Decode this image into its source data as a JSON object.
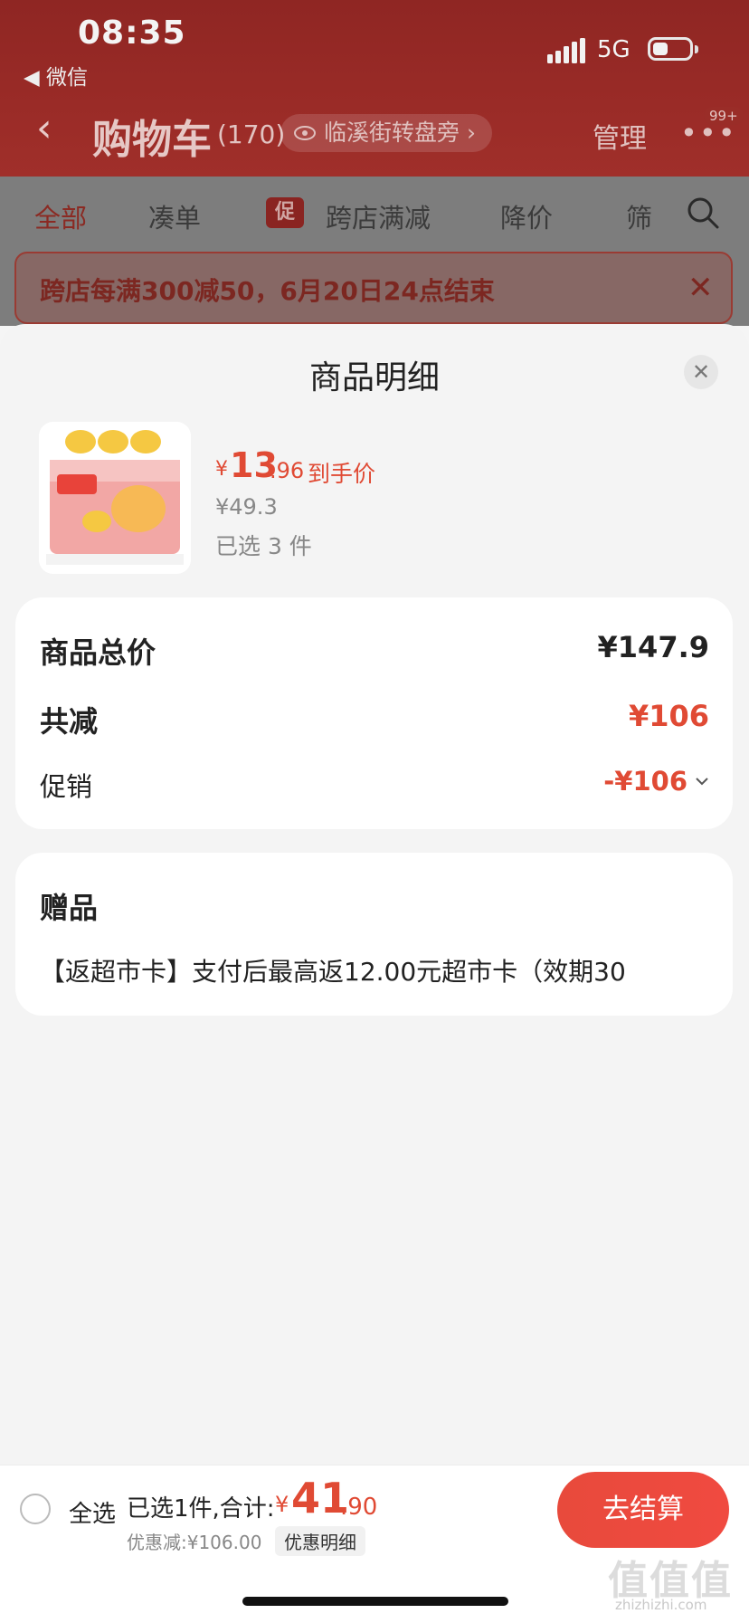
{
  "status_bar": {
    "time": "08:35",
    "back_app": "◀ 微信",
    "network": "5G"
  },
  "header": {
    "back_icon": "chevron-left-icon",
    "title": "购物车",
    "count": "(170)",
    "location": "临溪街转盘旁",
    "manage": "管理",
    "more": "•••",
    "badge": "99+"
  },
  "tabs": {
    "items": [
      "全部",
      "凑单",
      "跨店满减",
      "降价",
      "筛"
    ],
    "promo_tag": "促"
  },
  "banner": {
    "text": "跨店每满300减50，6月20日24点结束",
    "close": "✕"
  },
  "sheet": {
    "title": "商品明细",
    "close": "✕",
    "product": {
      "price_symbol": "¥",
      "price_integer": "13",
      "price_decimal": ".96",
      "price_label": "到手价",
      "original_price": "¥49.3",
      "selected": "已选 3 件"
    },
    "summary": {
      "total_label": "商品总价",
      "total_value": "¥147.9",
      "reduced_label": "共减",
      "reduced_value": "¥106",
      "promo_label": "促销",
      "promo_value": "-¥106"
    },
    "gift": {
      "title": "赠品",
      "text": "【返超市卡】支付后最高返12.00元超市卡（效期30"
    }
  },
  "bottom_bar": {
    "select_all": "全选",
    "total_label": "已选1件,合计:",
    "total_symbol": "¥",
    "total_integer": "41",
    "total_decimal": ".90",
    "discount": "优惠减:¥106.00",
    "discount_detail": "优惠明细",
    "checkout": "去结算"
  },
  "watermark": {
    "text": "值值值",
    "sub": "zhizhizhi.com"
  },
  "colors": {
    "accent": "#e04a34",
    "checkout": "#ee4a3e",
    "header": "#9a2b27"
  }
}
